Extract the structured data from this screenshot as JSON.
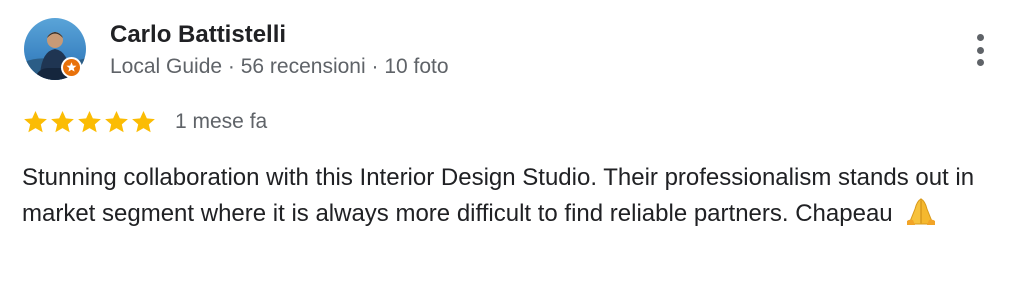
{
  "review": {
    "author": {
      "name": "Carlo Battistelli",
      "meta": "Local Guide · 56 recensioni · 10 foto",
      "avatar_icon": "user-photo",
      "badge_icon": "local-guide-star-icon"
    },
    "rating": {
      "stars": 5,
      "max": 5,
      "color": "#fbbc04"
    },
    "date": "1 mese fa",
    "text": "Stunning collaboration with this Interior Design Studio. Their professionalism stands out in market segment where it is always more difficult to find reliable partners. Chapeau",
    "emoji_icon": "folded-hands-emoji",
    "more_icon": "more-vert-icon"
  },
  "colors": {
    "badge": "#e8710a",
    "text_primary": "#202124",
    "text_secondary": "#5f6368"
  }
}
